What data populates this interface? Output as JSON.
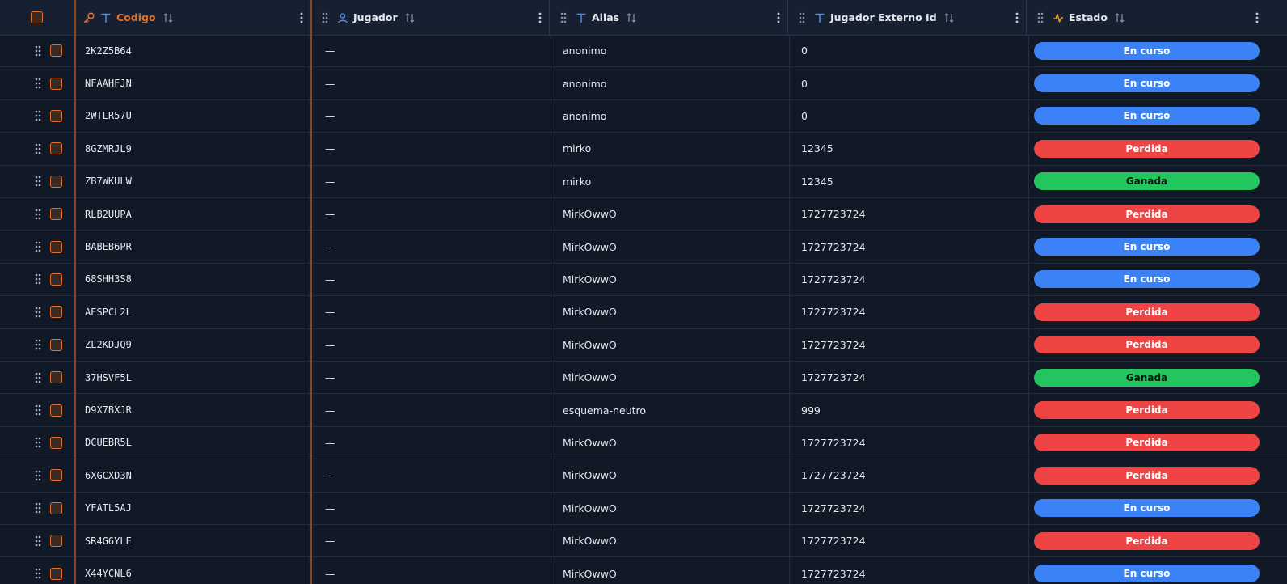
{
  "columns": [
    {
      "label": "Codigo",
      "type_icon": "text-type-icon",
      "key_icon": "key-icon"
    },
    {
      "label": "Jugador",
      "type_icon": "user-icon"
    },
    {
      "label": "Alias",
      "type_icon": "text-type-icon"
    },
    {
      "label": "Jugador Externo Id",
      "type_icon": "text-type-icon"
    },
    {
      "label": "Estado",
      "type_icon": "activity-icon"
    }
  ],
  "status_styles": {
    "En curso": {
      "bg": "#3b82f6",
      "fg": "#ffffff"
    },
    "Perdida": {
      "bg": "#ef4444",
      "fg": "#ffffff"
    },
    "Ganada": {
      "bg": "#22c55e",
      "fg": "#0b1a10"
    }
  },
  "accent_color": "#e0702a",
  "rows": [
    {
      "codigo": "2K2Z5B64",
      "jugador": "—",
      "alias": "anonimo",
      "externo": "0",
      "estado": "En curso"
    },
    {
      "codigo": "NFAAHFJN",
      "jugador": "—",
      "alias": "anonimo",
      "externo": "0",
      "estado": "En curso"
    },
    {
      "codigo": "2WTLR57U",
      "jugador": "—",
      "alias": "anonimo",
      "externo": "0",
      "estado": "En curso"
    },
    {
      "codigo": "8GZMRJL9",
      "jugador": "—",
      "alias": "mirko",
      "externo": "12345",
      "estado": "Perdida"
    },
    {
      "codigo": "ZB7WKULW",
      "jugador": "—",
      "alias": "mirko",
      "externo": "12345",
      "estado": "Ganada"
    },
    {
      "codigo": "RLB2UUPA",
      "jugador": "—",
      "alias": "MirkOwwO",
      "externo": "1727723724",
      "estado": "Perdida"
    },
    {
      "codigo": "BABEB6PR",
      "jugador": "—",
      "alias": "MirkOwwO",
      "externo": "1727723724",
      "estado": "En curso"
    },
    {
      "codigo": "68SHH3S8",
      "jugador": "—",
      "alias": "MirkOwwO",
      "externo": "1727723724",
      "estado": "En curso"
    },
    {
      "codigo": "AESPCL2L",
      "jugador": "—",
      "alias": "MirkOwwO",
      "externo": "1727723724",
      "estado": "Perdida"
    },
    {
      "codigo": "ZL2KDJQ9",
      "jugador": "—",
      "alias": "MirkOwwO",
      "externo": "1727723724",
      "estado": "Perdida"
    },
    {
      "codigo": "37HSVF5L",
      "jugador": "—",
      "alias": "MirkOwwO",
      "externo": "1727723724",
      "estado": "Ganada"
    },
    {
      "codigo": "D9X7BXJR",
      "jugador": "—",
      "alias": "esquema-neutro",
      "externo": "999",
      "estado": "Perdida"
    },
    {
      "codigo": "DCUEBR5L",
      "jugador": "—",
      "alias": "MirkOwwO",
      "externo": "1727723724",
      "estado": "Perdida"
    },
    {
      "codigo": "6XGCXD3N",
      "jugador": "—",
      "alias": "MirkOwwO",
      "externo": "1727723724",
      "estado": "Perdida"
    },
    {
      "codigo": "YFATL5AJ",
      "jugador": "—",
      "alias": "MirkOwwO",
      "externo": "1727723724",
      "estado": "En curso"
    },
    {
      "codigo": "SR4G6YLE",
      "jugador": "—",
      "alias": "MirkOwwO",
      "externo": "1727723724",
      "estado": "Perdida"
    },
    {
      "codigo": "X44YCNL6",
      "jugador": "—",
      "alias": "MirkOwwO",
      "externo": "1727723724",
      "estado": "En curso"
    }
  ]
}
